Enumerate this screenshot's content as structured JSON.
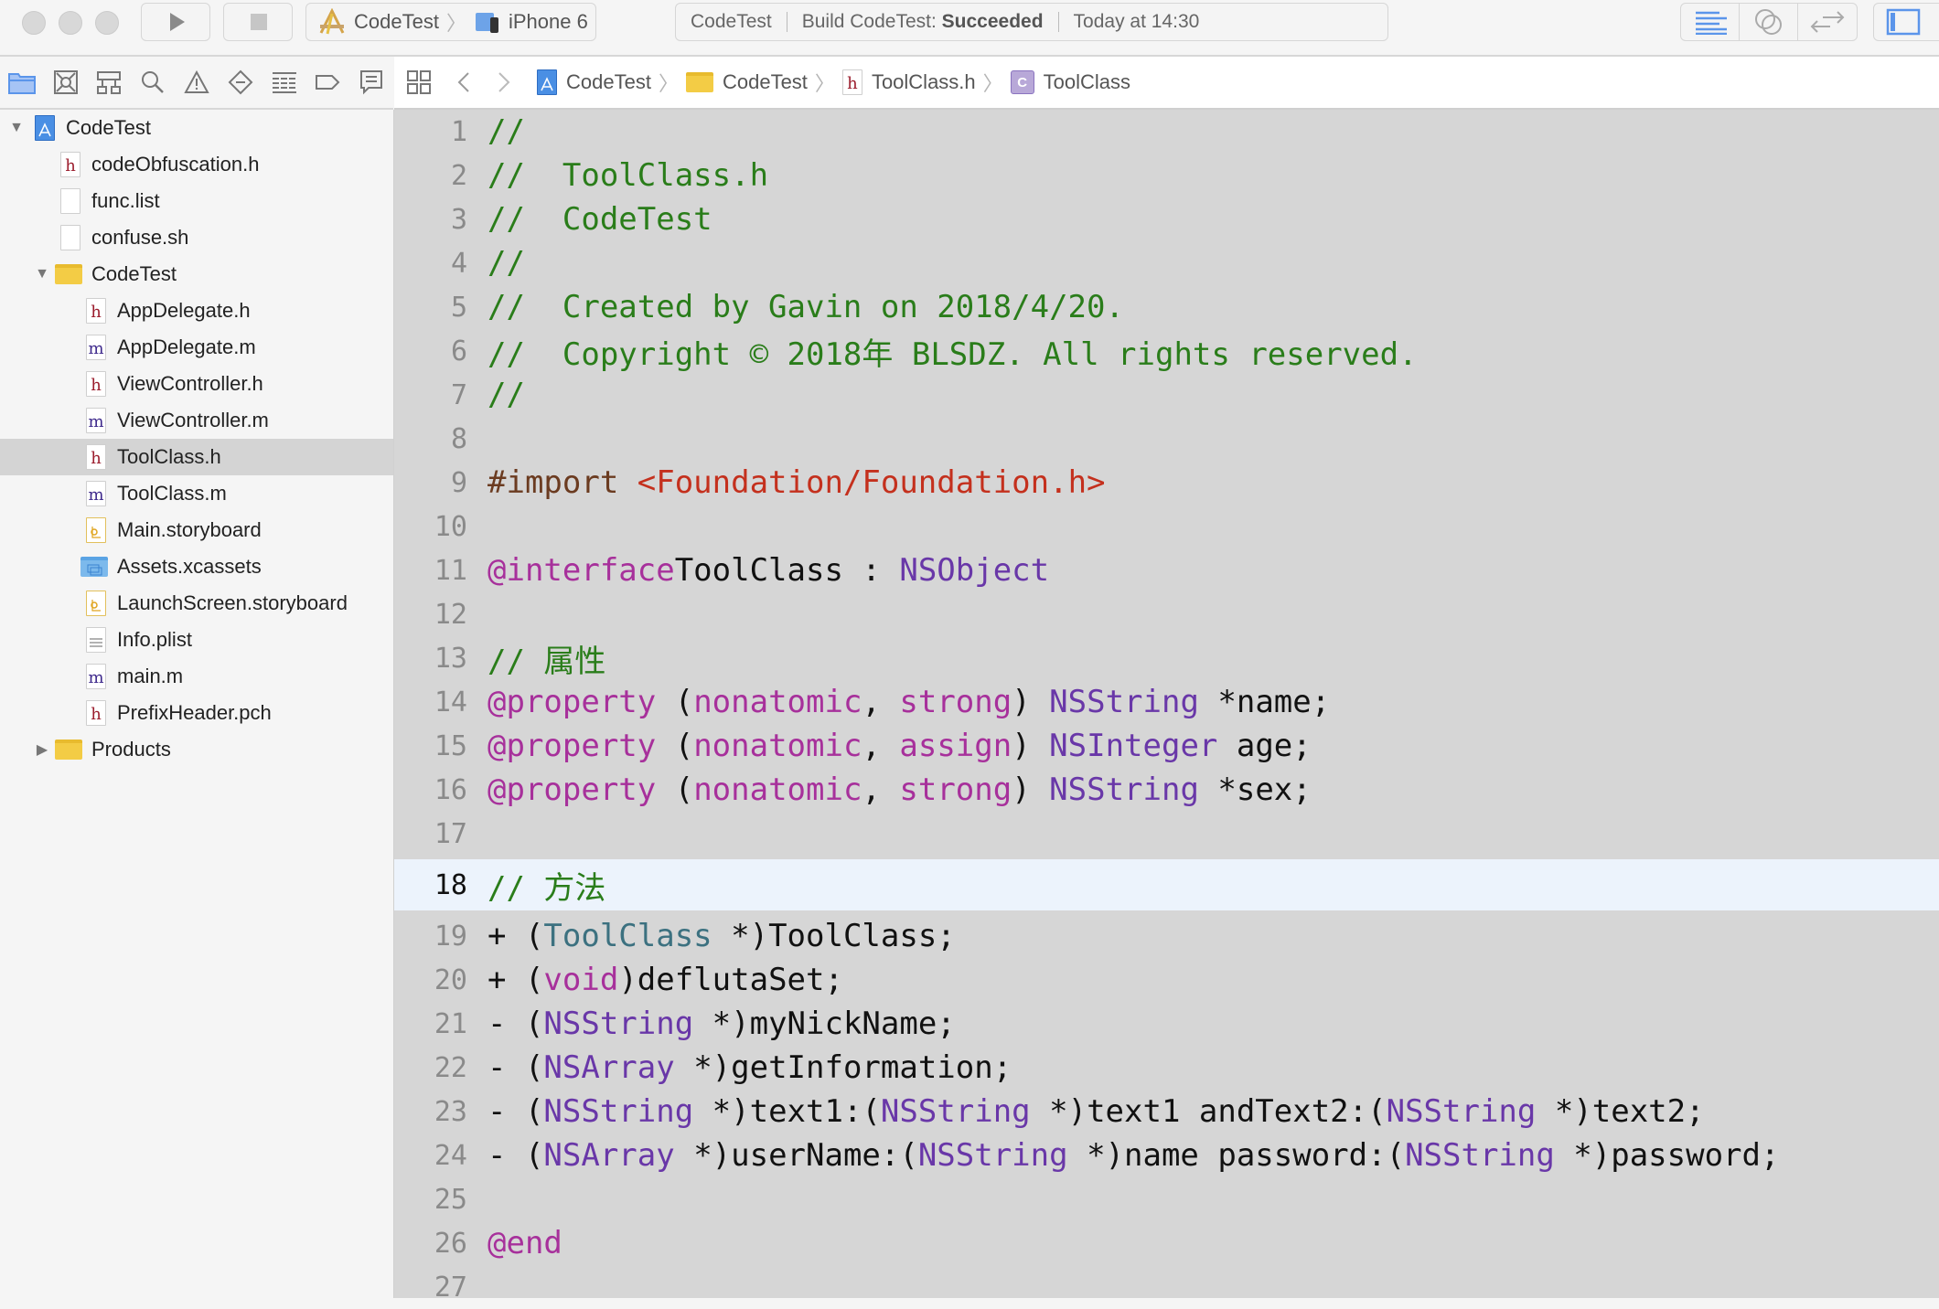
{
  "toolbar": {
    "scheme": {
      "project": "CodeTest",
      "device": "iPhone 6"
    },
    "status": {
      "project": "CodeTest",
      "action_prefix": "Build CodeTest: ",
      "result": "Succeeded",
      "time": "Today at 14:30"
    }
  },
  "navigator": {
    "tabs": [
      "project-navigator",
      "source-control-navigator",
      "symbol-navigator",
      "find-navigator",
      "issue-navigator",
      "test-navigator",
      "debug-navigator",
      "breakpoint-navigator",
      "report-navigator"
    ],
    "items": [
      {
        "label": "CodeTest",
        "type": "project",
        "level": 0,
        "expanded": true
      },
      {
        "label": "codeObfuscation.h",
        "type": "h",
        "level": 1
      },
      {
        "label": "func.list",
        "type": "plain",
        "level": 1
      },
      {
        "label": "confuse.sh",
        "type": "plain",
        "level": 1
      },
      {
        "label": "CodeTest",
        "type": "folder",
        "level": 1,
        "expanded": true
      },
      {
        "label": "AppDelegate.h",
        "type": "h",
        "level": 2
      },
      {
        "label": "AppDelegate.m",
        "type": "m",
        "level": 2
      },
      {
        "label": "ViewController.h",
        "type": "h",
        "level": 2
      },
      {
        "label": "ViewController.m",
        "type": "m",
        "level": 2
      },
      {
        "label": "ToolClass.h",
        "type": "h",
        "level": 2,
        "selected": true
      },
      {
        "label": "ToolClass.m",
        "type": "m",
        "level": 2
      },
      {
        "label": "Main.storyboard",
        "type": "storyboard",
        "level": 2
      },
      {
        "label": "Assets.xcassets",
        "type": "assets",
        "level": 2
      },
      {
        "label": "LaunchScreen.storyboard",
        "type": "storyboard",
        "level": 2
      },
      {
        "label": "Info.plist",
        "type": "plist",
        "level": 2
      },
      {
        "label": "main.m",
        "type": "m",
        "level": 2
      },
      {
        "label": "PrefixHeader.pch",
        "type": "h",
        "level": 2
      },
      {
        "label": "Products",
        "type": "folder",
        "level": 1,
        "expanded": false
      }
    ]
  },
  "jumpbar": {
    "crumbs": [
      {
        "label": "CodeTest",
        "icon": "project"
      },
      {
        "label": "CodeTest",
        "icon": "folder"
      },
      {
        "label": "ToolClass.h",
        "icon": "h"
      },
      {
        "label": "ToolClass",
        "icon": "class"
      }
    ]
  },
  "editor": {
    "current_line": 18,
    "lines": [
      [
        [
          "c-comment",
          "//"
        ]
      ],
      [
        [
          "c-comment",
          "//  ToolClass.h"
        ]
      ],
      [
        [
          "c-comment",
          "//  CodeTest"
        ]
      ],
      [
        [
          "c-comment",
          "//"
        ]
      ],
      [
        [
          "c-comment",
          "//  Created by Gavin on 2018/4/20."
        ]
      ],
      [
        [
          "c-comment",
          "//  Copyright © 2018年 BLSDZ. All rights reserved."
        ]
      ],
      [
        [
          "c-comment",
          "//"
        ]
      ],
      [],
      [
        [
          "c-pre",
          "#import "
        ],
        [
          "c-str",
          "<Foundation/Foundation.h>"
        ]
      ],
      [],
      [
        [
          "c-kw",
          "@interface"
        ],
        [
          "",
          "ToolClass : "
        ],
        [
          "c-type",
          "NSObject"
        ]
      ],
      [],
      [
        [
          "c-comment",
          "// 属性"
        ]
      ],
      [
        [
          "c-kw",
          "@property"
        ],
        [
          "",
          " ("
        ],
        [
          "c-kw",
          "nonatomic"
        ],
        [
          "",
          ", "
        ],
        [
          "c-kw",
          "strong"
        ],
        [
          "",
          ") "
        ],
        [
          "c-type",
          "NSString"
        ],
        [
          "",
          " *name;"
        ]
      ],
      [
        [
          "c-kw",
          "@property"
        ],
        [
          "",
          " ("
        ],
        [
          "c-kw",
          "nonatomic"
        ],
        [
          "",
          ", "
        ],
        [
          "c-kw",
          "assign"
        ],
        [
          "",
          ") "
        ],
        [
          "c-type",
          "NSInteger"
        ],
        [
          "",
          " age;"
        ]
      ],
      [
        [
          "c-kw",
          "@property"
        ],
        [
          "",
          " ("
        ],
        [
          "c-kw",
          "nonatomic"
        ],
        [
          "",
          ", "
        ],
        [
          "c-kw",
          "strong"
        ],
        [
          "",
          ") "
        ],
        [
          "c-type",
          "NSString"
        ],
        [
          "",
          " *sex;"
        ]
      ],
      [],
      [
        [
          "c-comment",
          "// 方法"
        ]
      ],
      [
        [
          "",
          "+ ("
        ],
        [
          "c-cls",
          "ToolClass"
        ],
        [
          "",
          " *)ToolClass;"
        ]
      ],
      [
        [
          "",
          "+ ("
        ],
        [
          "c-kw",
          "void"
        ],
        [
          "",
          ")deflutaSet;"
        ]
      ],
      [
        [
          "",
          "- ("
        ],
        [
          "c-type",
          "NSString"
        ],
        [
          "",
          " *)myNickName;"
        ]
      ],
      [
        [
          "",
          "- ("
        ],
        [
          "c-type",
          "NSArray"
        ],
        [
          "",
          " *)getInformation;"
        ]
      ],
      [
        [
          "",
          "- ("
        ],
        [
          "c-type",
          "NSString"
        ],
        [
          "",
          " *)text1:("
        ],
        [
          "c-type",
          "NSString"
        ],
        [
          "",
          " *)text1 andText2:("
        ],
        [
          "c-type",
          "NSString"
        ],
        [
          "",
          " *)text2;"
        ]
      ],
      [
        [
          "",
          "- ("
        ],
        [
          "c-type",
          "NSArray"
        ],
        [
          "",
          " *)userName:("
        ],
        [
          "c-type",
          "NSString"
        ],
        [
          "",
          " *)name password:("
        ],
        [
          "c-type",
          "NSString"
        ],
        [
          "",
          " *)password;"
        ]
      ],
      [],
      [
        [
          "c-kw",
          "@end"
        ]
      ],
      []
    ]
  }
}
